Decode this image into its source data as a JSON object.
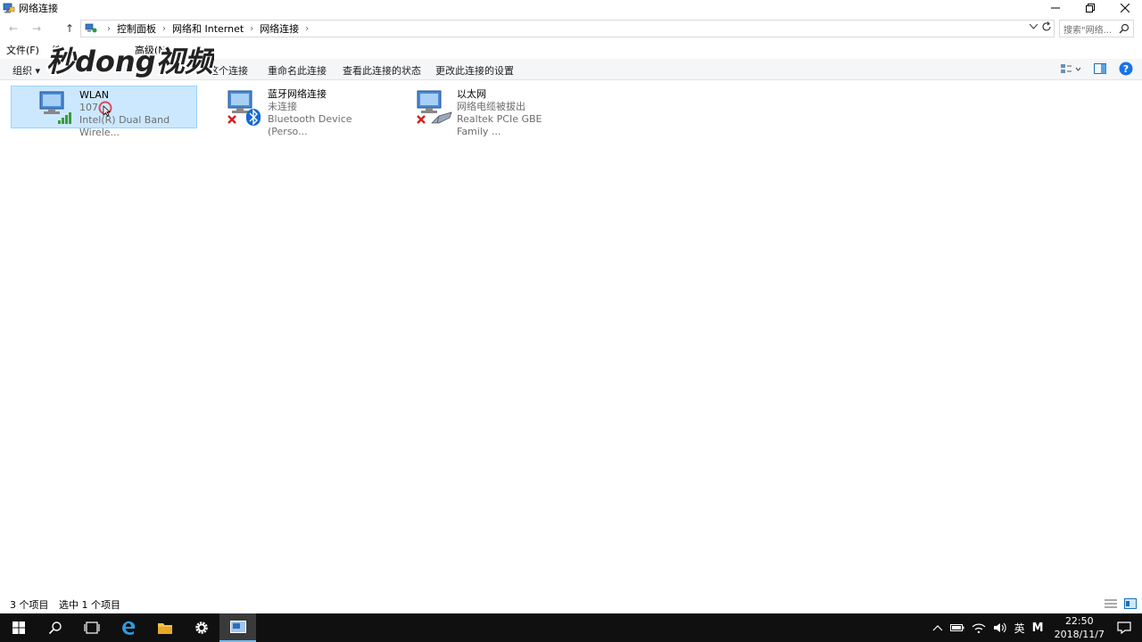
{
  "window": {
    "title": "网络连接"
  },
  "nav": {
    "back": "←",
    "forward": "→",
    "up": "↑"
  },
  "address": {
    "crumbs": [
      "控制面板",
      "网络和 Internet",
      "网络连接"
    ],
    "search_placeholder": "搜索\"网络..."
  },
  "menu": {
    "file": "文件(F)",
    "edit": "编",
    "advanced": "高级(N)"
  },
  "watermark": {
    "text": "秒dong视频"
  },
  "commands": {
    "organize": "组织 ▾",
    "disable": "这个连接",
    "rename": "重命名此连接",
    "status": "查看此连接的状态",
    "settings": "更改此连接的设置"
  },
  "connections": [
    {
      "name": "WLAN",
      "status": "107",
      "device": "Intel(R) Dual Band Wirele...",
      "icon": "wifi-network-icon",
      "selected": true
    },
    {
      "name": "蓝牙网络连接",
      "status": "未连接",
      "device": "Bluetooth Device (Perso...",
      "icon": "bluetooth-network-icon",
      "selected": false
    },
    {
      "name": "以太网",
      "status": "网络电缆被拔出",
      "device": "Realtek PCIe GBE Family ...",
      "icon": "ethernet-network-icon",
      "selected": false
    }
  ],
  "statusbar": {
    "items": "3 个项目",
    "selected": "选中 1 个项目"
  },
  "tray": {
    "ime": "英",
    "ime2": "M",
    "time": "22:50",
    "date": "2018/11/7"
  },
  "colors": {
    "selection_bg": "#cce8ff",
    "selection_border": "#99d1ff",
    "taskbar": "#101010",
    "accent": "#0078d7"
  }
}
